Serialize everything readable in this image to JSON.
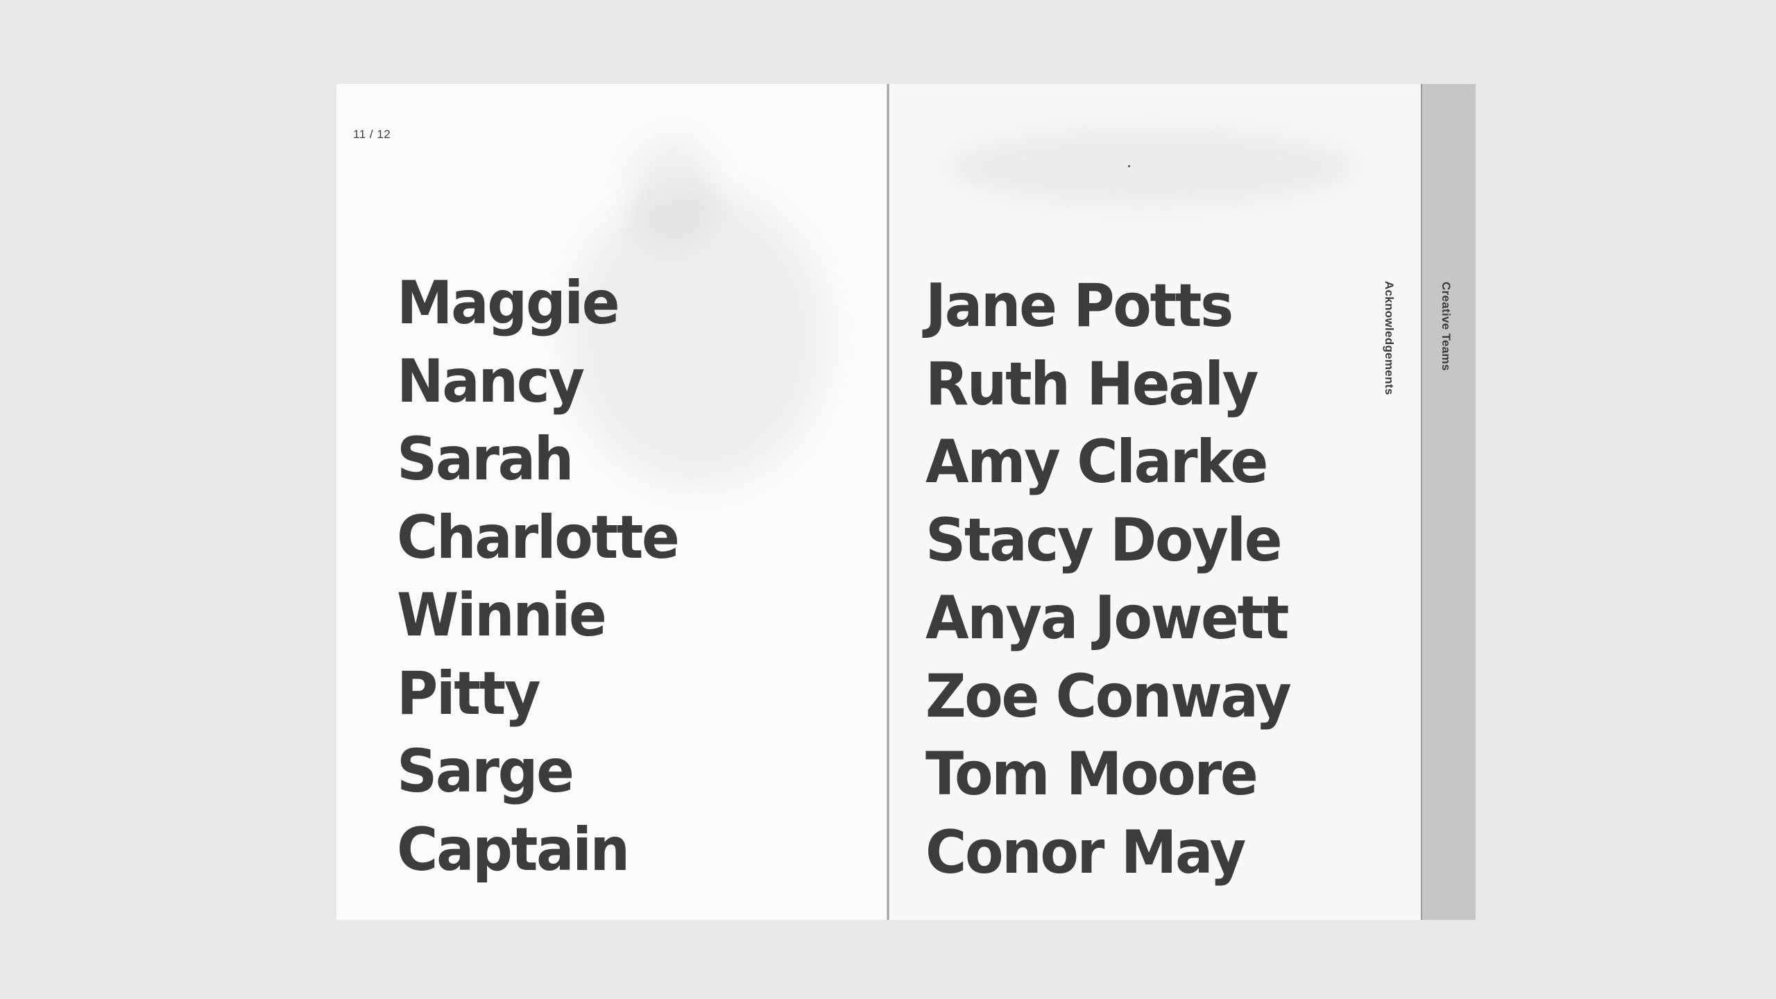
{
  "page_number": "11 / 12",
  "left_names": [
    "Maggie",
    "Nancy",
    "Sarah",
    "Charlotte",
    "Winnie",
    "Pitty",
    "Sarge",
    "Captain"
  ],
  "right_names": [
    "Jane Potts",
    "Ruth Healy",
    "Amy Clarke",
    "Stacy Doyle",
    "Anya Jowett",
    "Zoe Conway",
    "Tom Moore",
    "Conor May"
  ],
  "side_tabs": {
    "acknowledgements": "Acknowledgements",
    "creative_teams": "Creative Teams"
  },
  "colors": {
    "background": "#e8e8ea",
    "paper": "#fafaf9",
    "text": "#3b3c3d",
    "tab": "#c6c6c6"
  }
}
